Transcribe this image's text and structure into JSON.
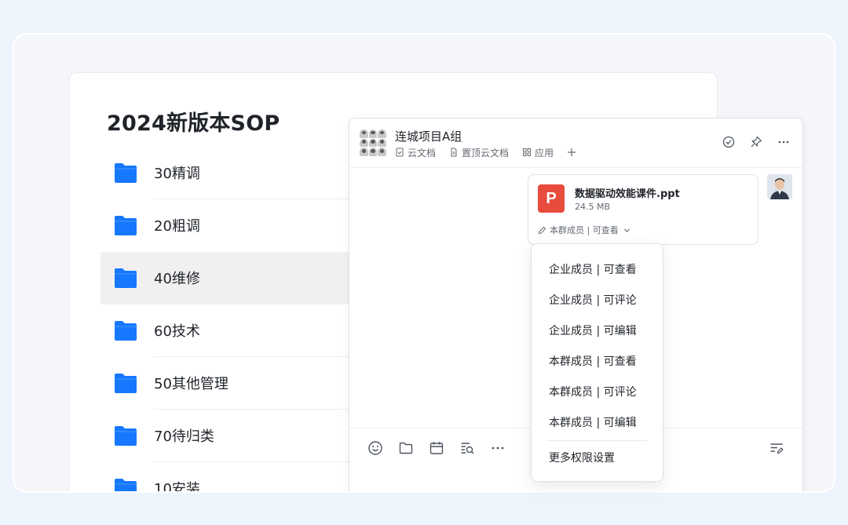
{
  "folder_panel": {
    "title": "2024新版本SOP",
    "folders": [
      {
        "label": "30精调",
        "selected": false
      },
      {
        "label": "20粗调",
        "selected": false
      },
      {
        "label": "40维修",
        "selected": true
      },
      {
        "label": "60技术",
        "selected": false
      },
      {
        "label": "50其他管理",
        "selected": false
      },
      {
        "label": "70待归类",
        "selected": false
      },
      {
        "label": "10安装",
        "selected": false
      }
    ]
  },
  "chat": {
    "title": "连城项目A组",
    "tabs": [
      {
        "label": "云文档",
        "icon": "doc-icon"
      },
      {
        "label": "置顶云文档",
        "icon": "pinned-doc-icon"
      },
      {
        "label": "应用",
        "icon": "apps-icon"
      }
    ],
    "add_tab_icon": "plus-icon",
    "header_actions": [
      "check-circle-icon",
      "pin-icon",
      "more-icon"
    ],
    "message": {
      "file_name": "数据驱动效能课件.ppt",
      "file_size": "24.5 MB",
      "file_icon_letter": "P",
      "permission": "本群成员 | 可查看"
    },
    "toolbar": [
      "emoji-icon",
      "folder-icon",
      "calendar-icon",
      "search-list-icon",
      "more-icon"
    ],
    "toolbar_right": "format-icon"
  },
  "permission_menu": {
    "options": [
      "企业成员 | 可查看",
      "企业成员 | 可评论",
      "企业成员 | 可编辑",
      "本群成员 | 可查看",
      "本群成员 | 可评论",
      "本群成员 | 可编辑"
    ],
    "more": "更多权限设置"
  },
  "colors": {
    "folder": "#1677ff",
    "ppt": "#e74c3c",
    "background": "#eef4fc"
  }
}
